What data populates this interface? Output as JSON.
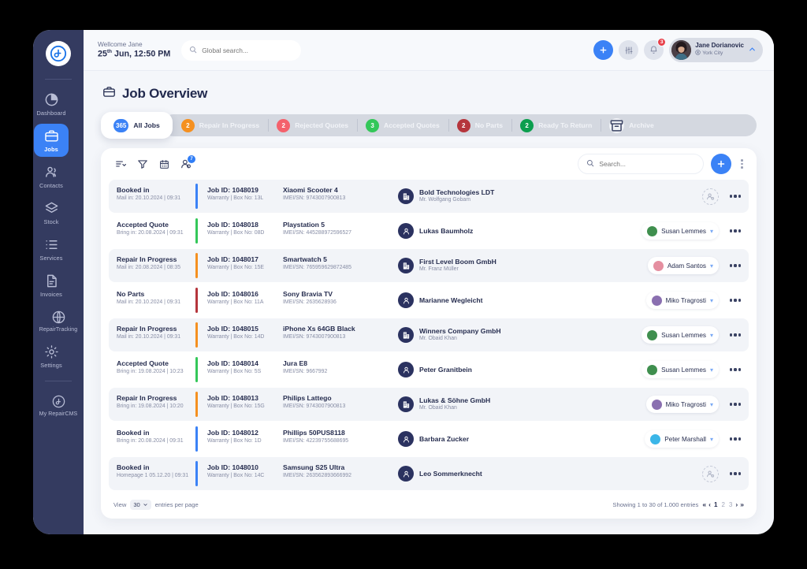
{
  "brand": {
    "logo_icon": "repaircms-logo-icon",
    "accent": "#3b82f6",
    "sidebar_bg": "#343b60"
  },
  "sidebar": {
    "items": [
      {
        "label": "Dashboard",
        "icon": "pie-chart-icon",
        "active": false
      },
      {
        "label": "Jobs",
        "icon": "briefcase-icon",
        "active": true
      },
      {
        "label": "Contacts",
        "icon": "users-icon",
        "active": false
      },
      {
        "label": "Stock",
        "icon": "layers-icon",
        "active": false
      },
      {
        "label": "Services",
        "icon": "list-icon",
        "active": false
      },
      {
        "label": "Invoices",
        "icon": "document-icon",
        "active": false
      },
      {
        "label": "RepairTracking",
        "icon": "globe-icon",
        "active": false
      },
      {
        "label": "Settings",
        "icon": "gear-icon",
        "active": false
      }
    ],
    "footer_item": {
      "label": "My RepairCMS",
      "icon": "repaircms-badge-icon"
    }
  },
  "header": {
    "welcome_line": "Wellcome Jane",
    "datetime": "25",
    "datetime_sup": "th",
    "datetime_rest": " Jun, 12:50 PM",
    "search_placeholder": "Global search...",
    "add_icon": "plus-icon",
    "settings_icon": "sliders-icon",
    "bell_icon": "bell-icon",
    "notification_count": "3",
    "user": {
      "name": "Jane Dorianovic",
      "location": "York City",
      "location_icon": "location-user-icon",
      "chevron": "chevron-up-icon"
    }
  },
  "page": {
    "title": "Job Overview",
    "title_icon": "briefcase-icon"
  },
  "status_tabs": [
    {
      "count": "365",
      "label": "All Jobs",
      "color": "#3b82f6",
      "active": true
    },
    {
      "count": "2",
      "label": "Repair In Progress",
      "color": "#f59020",
      "active": false
    },
    {
      "count": "2",
      "label": "Rejected Quotes",
      "color": "#f4616c",
      "active": false
    },
    {
      "count": "3",
      "label": "Accepted Quotes",
      "color": "#34c759",
      "active": false
    },
    {
      "count": "2",
      "label": "No Parts",
      "color": "#b5353c",
      "active": false
    },
    {
      "count": "2",
      "label": "Ready To Return",
      "color": "#0c9e4e",
      "active": false
    },
    {
      "count": "",
      "label": "Archive",
      "color": "#eef0f5",
      "active": false,
      "icon": "archive-icon"
    }
  ],
  "toolbar": {
    "icons": [
      {
        "name": "sort-icon",
        "badge": ""
      },
      {
        "name": "filter-icon",
        "badge": ""
      },
      {
        "name": "calendar-icon",
        "badge": ""
      },
      {
        "name": "assign-user-icon",
        "badge": "7"
      }
    ],
    "search_placeholder": "Search...",
    "add_icon": "plus-icon",
    "more_icon": "kebab-menu-icon"
  },
  "rows": [
    {
      "status": "Booked in",
      "status_sub": "Mail in: 20.10.2024 |  09:31",
      "color": "#3b82f6",
      "job_id": "Job ID: 1048019",
      "job_sub": "Warranty | Box No: 13L",
      "device": "Xiaomi Scooter 4",
      "device_sub": "IMEI/SN: 9743007900813",
      "customer": "Bold Technologies LDT",
      "customer_sub": "Mr. Wolfgang Gobam",
      "customer_type": "company",
      "assignee": "",
      "assignee_color": ""
    },
    {
      "status": "Accepted Quote",
      "status_sub": "Bring in: 20.08.2024 |  09:31",
      "color": "#34c759",
      "job_id": "Job ID: 1048018",
      "job_sub": "Warranty | Box No: 08D",
      "device": "Playstation 5",
      "device_sub": "IMEI/SN: 445288972596527",
      "customer": "Lukas Baumholz",
      "customer_sub": "",
      "customer_type": "person",
      "assignee": "Susan Lemmes",
      "assignee_color": "#3f8f4e"
    },
    {
      "status": "Repair In Progress",
      "status_sub": "Mail in: 20.08.2024 |  08:35",
      "color": "#f59020",
      "job_id": "Job ID: 1048017",
      "job_sub": "Warranty | Box No: 15E",
      "device": "Smartwatch 5",
      "device_sub": "IMEI/SN: 765959629872485",
      "customer": "First Level Boom GmbH",
      "customer_sub": "Mr. Franz Müller",
      "customer_type": "company",
      "assignee": "Adam Santos",
      "assignee_color": "#e58fa0"
    },
    {
      "status": "No Parts",
      "status_sub": "Mail in: 20.10.2024 |  09:31",
      "color": "#b5353c",
      "job_id": "Job ID: 1048016",
      "job_sub": "Warranty | Box No: 11A",
      "device": "Sony Bravia TV",
      "device_sub": "IMEI/SN: 2635628936",
      "customer": "Marianne Wegleicht",
      "customer_sub": "",
      "customer_type": "person",
      "assignee": "Miko Tragrosti",
      "assignee_color": "#8a6fb0"
    },
    {
      "status": "Repair In Progress",
      "status_sub": "Mail in: 20.10.2024 |  09:31",
      "color": "#f59020",
      "job_id": "Job ID: 1048015",
      "job_sub": "Warranty | Box No: 14D",
      "device": "iPhone Xs 64GB Black",
      "device_sub": "IMEI/SN: 9743007900813",
      "customer": "Winners Company GmbH",
      "customer_sub": "Mr. Obaid Khan",
      "customer_type": "company",
      "assignee": "Susan Lemmes",
      "assignee_color": "#3f8f4e"
    },
    {
      "status": "Accepted Quote",
      "status_sub": "Bring in: 19.08.2024 |  10:23",
      "color": "#34c759",
      "job_id": "Job ID: 1048014",
      "job_sub": "Warranty | Box No: 5S",
      "device": "Jura E8",
      "device_sub": "IMEI/SN: 9667992",
      "customer": "Peter Granitbein",
      "customer_sub": "",
      "customer_type": "person",
      "assignee": "Susan Lemmes",
      "assignee_color": "#3f8f4e"
    },
    {
      "status": "Repair In Progress",
      "status_sub": "Bring in: 19.08.2024 |  10:20",
      "color": "#f59020",
      "job_id": "Job ID: 1048013",
      "job_sub": "Warranty | Box No: 15G",
      "device": "Philips Lattego",
      "device_sub": "IMEI/SN: 9743007900813",
      "customer": "Lukas & Söhne GmbH",
      "customer_sub": "Mr. Obaid Khan",
      "customer_type": "company",
      "assignee": "Miko Tragrosti",
      "assignee_color": "#8a6fb0"
    },
    {
      "status": "Booked in",
      "status_sub": "Bring in: 20.08.2024 |  09:31",
      "color": "#3b82f6",
      "job_id": "Job ID: 1048012",
      "job_sub": "Warranty | Box No: 1D",
      "device": "Phillips 50PUS8118",
      "device_sub": "IMEI/SN: 42239755688695",
      "customer": "Barbara Zucker",
      "customer_sub": "",
      "customer_type": "person",
      "assignee": "Peter Marshall",
      "assignee_color": "#3bb6e8"
    },
    {
      "status": "Booked in",
      "status_sub": "Homepage 1   05.12.20 |  09:31",
      "color": "#3b82f6",
      "job_id": "Job ID: 1048010",
      "job_sub": "Warranty | Box No: 14C",
      "device": "Samsung S25 Ultra",
      "device_sub": "IMEI/SN: 263562893666992",
      "customer": "Leo Sommerknecht",
      "customer_sub": "",
      "customer_type": "person",
      "assignee": "",
      "assignee_color": ""
    }
  ],
  "footer": {
    "view_label": "View",
    "per_page_value": "30",
    "per_page_suffix": "entries per page",
    "showing_text": "Showing 1 to 30 of 1.000 entries",
    "pages": [
      "1",
      "2",
      "3"
    ],
    "current_page": "1",
    "first_icon": "double-chevron-left-icon",
    "prev_icon": "chevron-left-icon",
    "next_icon": "chevron-right-icon",
    "last_icon": "double-chevron-right-icon"
  }
}
